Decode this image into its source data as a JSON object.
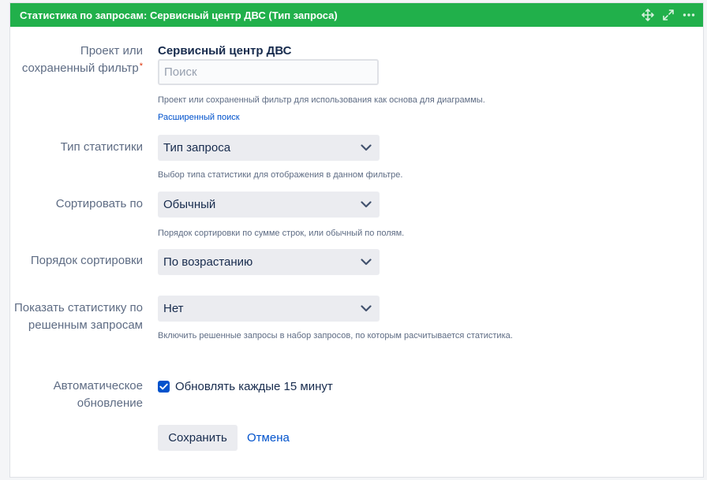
{
  "header": {
    "title": "Статистика по запросам: Сервисный центр ДВС (Тип запроса)",
    "icons": [
      "move-icon",
      "expand-icon",
      "more-icon"
    ]
  },
  "form": {
    "project": {
      "label": "Проект или сохраненный фильтр",
      "required_mark": "*",
      "selected_name": "Сервисный центр ДВС",
      "search_placeholder": "Поиск",
      "search_value": "",
      "description": "Проект или сохраненный фильтр для использования как основа для диаграммы.",
      "advanced_link": "Расширенный поиск"
    },
    "stat_type": {
      "label": "Тип статистики",
      "value": "Тип запроса",
      "description": "Выбор типа статистики для отображения в данном фильтре."
    },
    "sort_by": {
      "label": "Сортировать по",
      "value": "Обычный",
      "description": "Порядок сортировки по сумме строк, или обычный по полям."
    },
    "sort_order": {
      "label": "Порядок сортировки",
      "value": "По возрастанию"
    },
    "show_resolved": {
      "label": "Показать статистику по решенным запросам",
      "value": "Нет",
      "description": "Включить решенные запросы в набор запросов, по которым расчитывается статистика."
    },
    "auto_refresh": {
      "label": "Автоматическое обновление",
      "checkbox_label": "Обновлять каждые 15 минут",
      "checked": true
    },
    "actions": {
      "save": "Сохранить",
      "cancel": "Отмена"
    }
  },
  "colors": {
    "header_bg": "#21b04b",
    "link": "#0052cc",
    "checkbox": "#0052cc",
    "select_bg": "#ebecf0"
  }
}
